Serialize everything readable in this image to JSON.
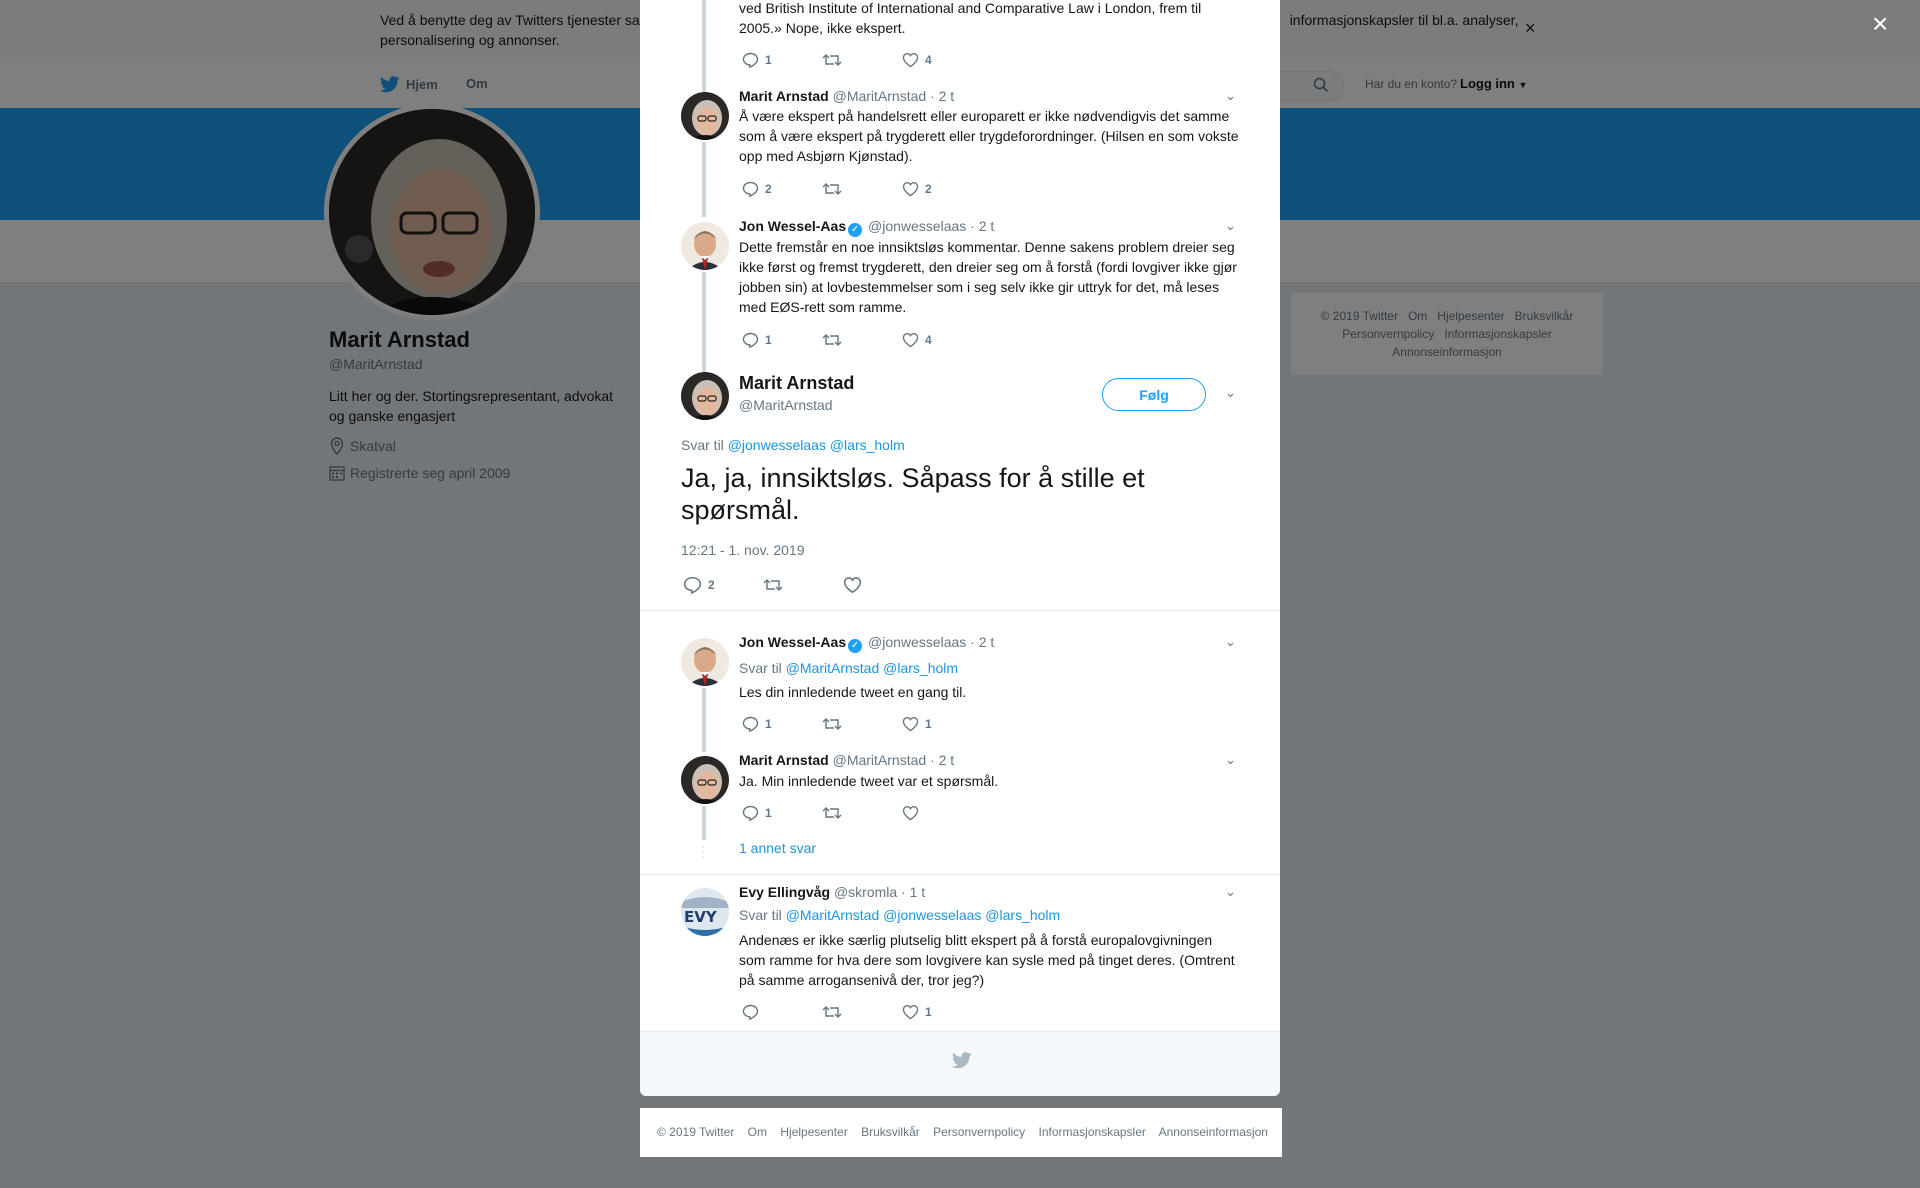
{
  "cookie": {
    "text_left": "Ved å benytte deg av Twitters tjenester sa",
    "text_right": "informasjonskapsler til bl.a. analyser,",
    "text_line2": "personalisering og annonser.",
    "close": "×"
  },
  "nav": {
    "home": "Hjem",
    "about": "Om",
    "has_account": "Har du en konto?",
    "login": "Logg inn"
  },
  "profile": {
    "name": "Marit Arnstad",
    "handle": "@MaritArnstad",
    "bio": "Litt her og der. Stortingsrepresentant, advokat og ganske engasjert",
    "location": "Skatval",
    "joined": "Registrerte seg april 2009"
  },
  "side_footer": {
    "row1": [
      "© 2019 Twitter",
      "Om",
      "Hjelpesenter",
      "Bruksvilkår"
    ],
    "row2": [
      "Personvernpolicy",
      "Informasjonskapsler"
    ],
    "row3": [
      "Annonseinformasjon"
    ]
  },
  "overlay_close": "×",
  "thread": {
    "t0": {
      "text": "ved British Institute of International and Comparative Law i London, frem til 2005.» Nope, ikke ekspert.",
      "replies": "1",
      "likes": "4"
    },
    "t1": {
      "name": "Marit Arnstad",
      "handle": "@MaritArnstad",
      "time": "· 2 t",
      "text": "Å være ekspert på handelsrett eller europarett er ikke nødvendigvis det samme som å være ekspert på trygderett eller trygdeforordninger. (Hilsen en som vokste opp med Asbjørn Kjønstad).",
      "replies": "2",
      "likes": "2"
    },
    "t2": {
      "name": "Jon Wessel-Aas",
      "handle": "@jonwesselaas",
      "time": "· 2 t",
      "text": "Dette fremstår en noe innsiktsløs kommentar. Denne sakens problem dreier seg ikke først og fremst trygderett, den dreier seg om å forstå (fordi lovgiver ikke gjør jobben sin) at lovbestemmelser som i seg selv ikke gir uttryk for det, må leses med EØS-rett som ramme.",
      "replies": "1",
      "likes": "4"
    }
  },
  "main_tweet": {
    "name": "Marit Arnstad",
    "handle": "@MaritArnstad",
    "follow": "Følg",
    "reply_to_label": "Svar til",
    "reply_to_links": "@jonwesselaas @lars_holm",
    "text": "Ja, ja, innsiktsløs. Såpass for å stille et spørsmål.",
    "timestamp": "12:21 - 1. nov. 2019",
    "replies": "2"
  },
  "replies": {
    "r1": {
      "name": "Jon Wessel-Aas",
      "handle": "@jonwesselaas",
      "time": "· 2 t",
      "reply_to_label": "Svar til",
      "reply_to_links": "@MaritArnstad @lars_holm",
      "text": "Les din innledende tweet en gang til.",
      "replies": "1",
      "likes": "1"
    },
    "r2": {
      "name": "Marit Arnstad",
      "handle": "@MaritArnstad",
      "time": "· 2 t",
      "text": "Ja. Min innledende tweet var et spørsmål.",
      "replies": "1"
    },
    "more_replies": "1 annet svar",
    "r3": {
      "name": "Evy Ellingvåg",
      "handle": "@skromla",
      "time": "· 1 t",
      "reply_to_label": "Svar til",
      "reply_to_links": "@MaritArnstad @jonwesselaas @lars_holm",
      "text": "Andenæs er ikke særlig plutselig blitt ekspert på å forstå europalovgivningen som ramme for hva dere som lovgivere kan sysle med på tinget deres. (Omtrent på samme arroganse­nivå der, tror jeg?)",
      "likes": "1"
    }
  },
  "footer": [
    "© 2019 Twitter",
    "Om",
    "Hjelpesenter",
    "Bruksvilkår",
    "Personvernpolicy",
    "Informasjonskapsler",
    "Annonseinformasjon"
  ],
  "colors": {
    "brand": "#1da1f2",
    "link": "#1b95e0",
    "muted": "#657786",
    "thread_line": "#ccd6dd"
  },
  "icons": [
    "twitter-bird-icon",
    "search-icon",
    "location-icon",
    "calendar-icon",
    "reply-icon",
    "retweet-icon",
    "like-icon",
    "chevron-down-icon",
    "verified-icon",
    "close-icon"
  ]
}
